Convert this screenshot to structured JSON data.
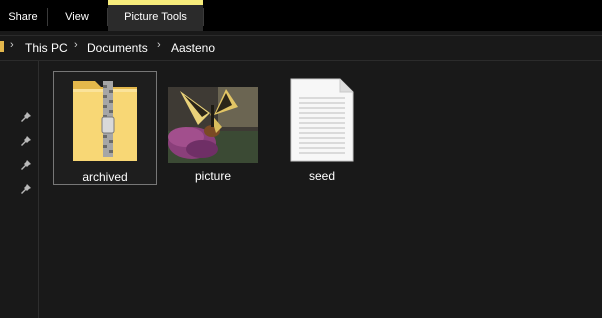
{
  "ribbon": {
    "tabs": [
      {
        "label": "Share"
      },
      {
        "label": "View"
      },
      {
        "label": "Picture Tools"
      }
    ],
    "accent_color": "#f7ec7c"
  },
  "address": {
    "crumbs": [
      "This PC",
      "Documents",
      "Aasteno"
    ],
    "separator": "›"
  },
  "nav": {
    "pins": [
      "pin-icon",
      "pin-icon",
      "pin-icon",
      "pin-icon"
    ]
  },
  "files": [
    {
      "name": "archived",
      "icon": "zip-folder-icon",
      "selected": true
    },
    {
      "name": "picture",
      "icon": "image-thumbnail",
      "selected": false
    },
    {
      "name": "seed",
      "icon": "text-document-icon",
      "selected": false
    }
  ],
  "colors": {
    "background": "#191919",
    "ribbon": "#000000",
    "folder": "#f8d775"
  }
}
